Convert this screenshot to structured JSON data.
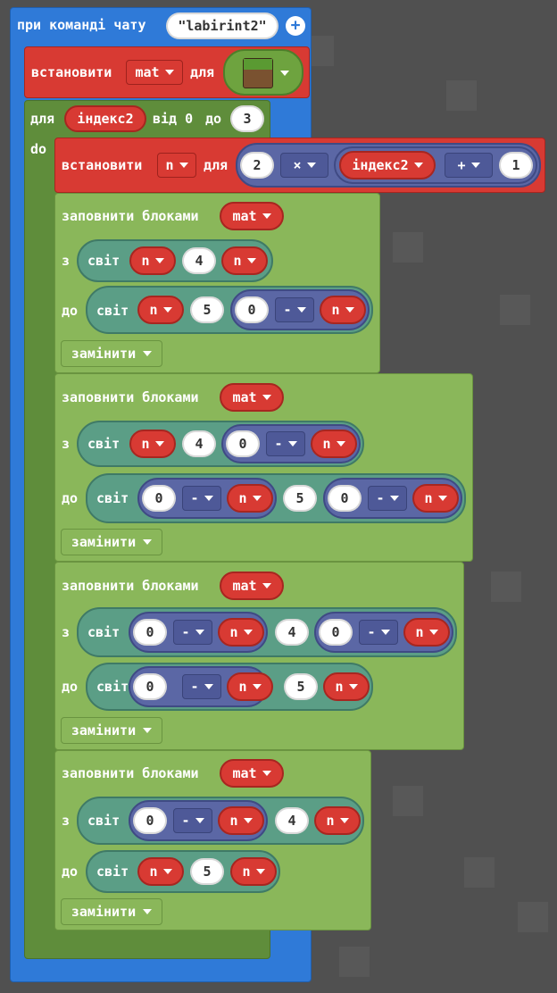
{
  "event": {
    "label": "при команді чату",
    "command": "labirint2",
    "add_icon": "plus-circle-icon"
  },
  "set_mat": {
    "label": "встановити",
    "var": "mat",
    "for": "для",
    "block_icon": "grass-block-icon"
  },
  "loop": {
    "label": "для",
    "var": "індекс2",
    "from": "від",
    "from_val": "0",
    "to": "до",
    "to_val": "3",
    "do": "do"
  },
  "set_n": {
    "label": "встановити",
    "var": "n",
    "for": "для",
    "a": "2",
    "mul": "×",
    "index": "індекс2",
    "plus": "+",
    "b": "1"
  },
  "fill1": {
    "label": "заповнити блоками",
    "mat": "mat",
    "from": "з",
    "world": "світ",
    "to": "до",
    "f_x": "n",
    "f_y": "4",
    "f_z": "n",
    "t_x": "n",
    "t_y": "5",
    "t_z_a": "0",
    "t_z_op": "-",
    "t_z_b": "n",
    "mode": "замінити"
  },
  "fill2": {
    "label": "заповнити блоками",
    "mat": "mat",
    "from": "з",
    "world": "світ",
    "to": "до",
    "f_x": "n",
    "f_y": "4",
    "f_z_a": "0",
    "f_z_op": "-",
    "f_z_b": "n",
    "t_x_a": "0",
    "t_x_op": "-",
    "t_x_b": "n",
    "t_y": "5",
    "t_z_a": "0",
    "t_z_op": "-",
    "t_z_b": "n",
    "mode": "замінити"
  },
  "fill3": {
    "label": "заповнити блоками",
    "mat": "mat",
    "from": "з",
    "world": "світ",
    "to": "до",
    "f_x_a": "0",
    "f_x_op": "-",
    "f_x_b": "n",
    "f_y": "4",
    "f_z_a": "0",
    "f_z_op": "-",
    "f_z_b": "n",
    "t_x_a": "0",
    "t_x_op": "-",
    "t_x_b": "n",
    "t_y": "5",
    "t_z": "n",
    "mode": "замінити"
  },
  "fill4": {
    "label": "заповнити блоками",
    "mat": "mat",
    "from": "з",
    "world": "світ",
    "to": "до",
    "f_x_a": "0",
    "f_x_op": "-",
    "f_x_b": "n",
    "f_y": "4",
    "f_z": "n",
    "t_x": "n",
    "t_y": "5",
    "t_z": "n",
    "mode": "замінити"
  }
}
